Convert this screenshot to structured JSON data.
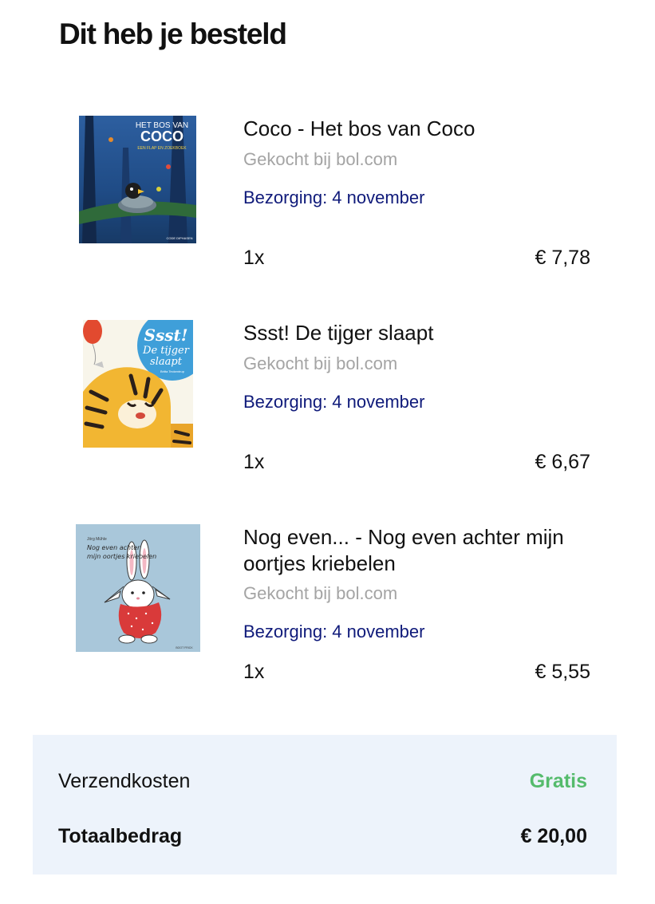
{
  "header": {
    "title": "Dit heb je besteld"
  },
  "items": [
    {
      "title": "Coco - Het bos van Coco",
      "seller": "Gekocht bij bol.com",
      "delivery": "Bezorging: 4 november",
      "quantity": "1x",
      "price": "€ 7,78",
      "cover": {
        "title_line1": "HET BOS VAN",
        "title_line2": "COCO",
        "subtitle": "EEN FLAP EN ZOEKBOEK",
        "publisher": "CODE DIPHASEN",
        "icon": "book-cover-forest-bird"
      }
    },
    {
      "title": "Ssst! De tijger slaapt",
      "seller": "Gekocht bij bol.com",
      "delivery": "Bezorging: 4 november",
      "quantity": "1x",
      "price": "€ 6,67",
      "cover": {
        "title_line1": "Ssst!",
        "title_line2": "De tijger",
        "title_line3": "slaapt",
        "author": "Britta Teckentrup",
        "icon": "book-cover-sleeping-tiger"
      }
    },
    {
      "title": "Nog even... - Nog even achter mijn oortjes kriebelen",
      "seller": "Gekocht bij bol.com",
      "delivery": "Bezorging: 4 november",
      "quantity": "1x",
      "price": "€ 5,55",
      "cover": {
        "author": "Jörg Mühle",
        "title_line1": "Nog even achter",
        "title_line2": "mijn oortjes kriebelen",
        "publisher": "BOOT FRICK",
        "icon": "book-cover-bunny"
      }
    }
  ],
  "summary": {
    "shipping_label": "Verzendkosten",
    "shipping_value": "Gratis",
    "total_label": "Totaalbedrag",
    "total_value": "€ 20,00"
  },
  "colors": {
    "delivery_text": "#0f1a7a",
    "seller_text": "#a4a4a4",
    "free_shipping": "#55bb6c",
    "summary_background": "#edf3fb"
  }
}
